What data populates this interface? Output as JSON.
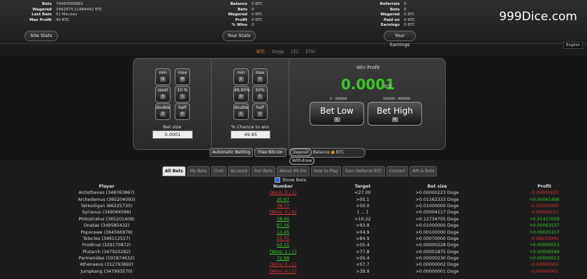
{
  "site_stats": {
    "rows": [
      {
        "k": "Bets",
        "v": "79483585883"
      },
      {
        "k": "Wagered",
        "v": "3482874.11884442 BTC"
      },
      {
        "k": "Last Rain",
        "v": "51 Minutes"
      },
      {
        "k": "Max Profit",
        "v": "40 BTC"
      }
    ],
    "button": "Site Stats"
  },
  "your_stats": {
    "rows": [
      {
        "k": "Balance",
        "v": "0 BTC"
      },
      {
        "k": "Bets",
        "v": "0"
      },
      {
        "k": "Wagered",
        "v": "0 BTC"
      },
      {
        "k": "Profit",
        "v": "0 BTC"
      },
      {
        "k": "% Wins",
        "v": "0"
      }
    ],
    "button": "Your Stats"
  },
  "your_earnings": {
    "rows": [
      {
        "k": "Referrals",
        "v": "0"
      },
      {
        "k": "Bets",
        "v": "0"
      },
      {
        "k": "Wagered",
        "v": "0 BTC"
      },
      {
        "k": "Paid on",
        "v": "0 BTC"
      },
      {
        "k": "Earnings",
        "v": "0 BTC"
      }
    ],
    "button": "Your Earnings"
  },
  "logo": "999Dice.com",
  "language": "English",
  "currencies": [
    "BTC",
    "Doge",
    "LTC",
    "ETH"
  ],
  "bet_panel": {
    "keys_left": [
      [
        "min",
        "Q"
      ],
      [
        "max",
        "W"
      ],
      [
        "reset",
        "A"
      ],
      [
        "10 %",
        "S"
      ],
      [
        "double",
        "Z"
      ],
      [
        "half",
        "X"
      ]
    ],
    "keys_chance": [
      [
        "min",
        "E"
      ],
      [
        "max",
        "R"
      ],
      [
        "49.95%",
        "D"
      ],
      [
        "50%",
        "F"
      ],
      [
        "double",
        "C"
      ],
      [
        "half",
        "V"
      ]
    ],
    "bet_size_label": "Bet size",
    "bet_size_value": "0.0001",
    "chance_label": "% Chance to win",
    "chance_value": "49.95",
    "win_profit_label": "Win Profit",
    "win_profit_value": "0.0001",
    "win_profit_unit": "BTC",
    "low_range": "0 - 499499",
    "high_range": "500500 - 999999",
    "bet_low": "Bet Low",
    "bet_low_key": "L",
    "bet_high": "Bet High",
    "bet_high_key": "H"
  },
  "actions": {
    "auto_betting": "Automatic Betting",
    "free_bitcoin": "Free Bitcoin",
    "deposit": "Deposit",
    "balance": "Balance",
    "balance_currency": "BTC",
    "withdraw": "Withdraw"
  },
  "tabs": [
    "All Bets",
    "My Bets",
    "Chat",
    "Account",
    "Fair Bets",
    "About 99.9%",
    "How to Play",
    "Earn Referral BTC",
    "Contact",
    "API & Bots"
  ],
  "show_bets_label": "Show Bets",
  "bets_table": {
    "headers": [
      "Player",
      "Number",
      "Target",
      "Bet size",
      "Profit"
    ],
    "rows": [
      [
        "Antisthenes (348763867)",
        "[Wins: 0 / 1]",
        "<27.00",
        ">0.00000223 Doge",
        "-0.00000223"
      ],
      [
        "Archedemus (365204093)",
        "20.67",
        ">05.1",
        ">0.01162333 Doge",
        "+0.00061496"
      ],
      [
        "YaHooligan (66225730)",
        "38.77",
        ">50.0",
        ">0.01000000 Doge",
        "-0.01000000"
      ],
      [
        "Syrianus (349064586)",
        "[Wins: 0 / 4]",
        "[ ... ]",
        ">0.00004117 Doge",
        "-0.00004117"
      ],
      [
        "Philostratus (365201409)",
        "18.45",
        ">10.22",
        ">0.12734705 Doge",
        "+0.01437009"
      ],
      [
        "Onatas (349585432)",
        "87.36",
        ">93.9",
        ">0.01000000 Doge",
        "+0.00063537"
      ],
      [
        "Popxceaw (364566978)",
        "13.45",
        ">04.9",
        ">0.00100000 Doge",
        "+0.00005157"
      ],
      [
        "Telecles (349112517)",
        "25.75",
        ">84.9",
        ">0.00070000 Doge",
        "-0.00070000"
      ],
      [
        "Prodicus (329170872)",
        "62.15",
        ">05.4",
        ">0.00000228 Doge",
        "+0.00000013"
      ],
      [
        "Plutarch (347920282)",
        "[Wins: 1 / 1]",
        ">77.8",
        ">0.00001875 Doge",
        "+0.00006589"
      ],
      [
        "Parmenides (191874632)",
        "72.88",
        ">05.4",
        ">0.00000230 Doge",
        "+0.00000013"
      ],
      [
        "Athenaeus (312793892)",
        "[Wins: 0 / 1]",
        "<07.7",
        ">0.00000002 Doge",
        "-0.00000002"
      ],
      [
        "Jumpkang (347993570)",
        "[Wins: 0 / 1]",
        ">39.9",
        ">0.00000001 Doge",
        "-0.00000001"
      ]
    ]
  }
}
